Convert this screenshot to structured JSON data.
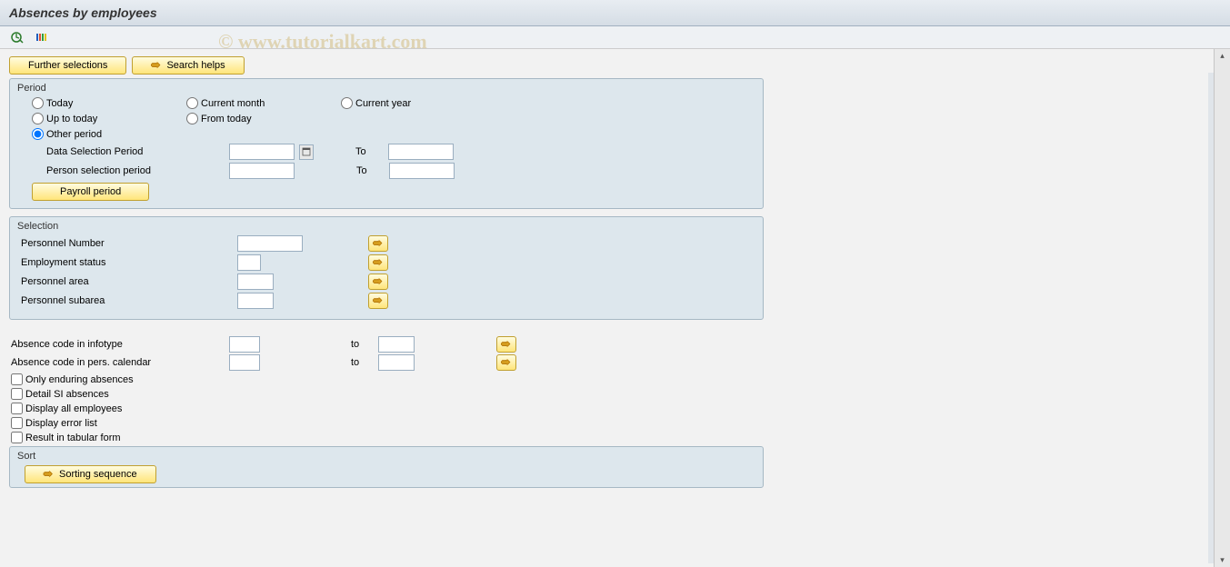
{
  "title": "Absences by employees",
  "watermark": "© www.tutorialkart.com",
  "toolbar_buttons": {
    "further_selections": "Further selections",
    "search_helps": "Search helps"
  },
  "period": {
    "legend": "Period",
    "options": {
      "today": "Today",
      "current_month": "Current month",
      "current_year": "Current year",
      "up_to_today": "Up to today",
      "from_today": "From today",
      "other_period": "Other period"
    },
    "selected": "other_period",
    "data_sel_label": "Data Selection Period",
    "person_sel_label": "Person selection period",
    "to_label": "To",
    "payroll_btn": "Payroll period"
  },
  "selection": {
    "legend": "Selection",
    "rows": [
      {
        "label": "Personnel Number"
      },
      {
        "label": "Employment status"
      },
      {
        "label": "Personnel area"
      },
      {
        "label": "Personnel subarea"
      }
    ]
  },
  "free_fields": {
    "absence_infotype": "Absence code in infotype",
    "absence_calendar": "Absence code in pers. calendar",
    "to_label": "to"
  },
  "checkboxes": [
    "Only enduring absences",
    "Detail SI absences",
    "Display all employees",
    "Display error list",
    "Result in tabular form"
  ],
  "sort": {
    "legend": "Sort",
    "button": "Sorting sequence"
  }
}
